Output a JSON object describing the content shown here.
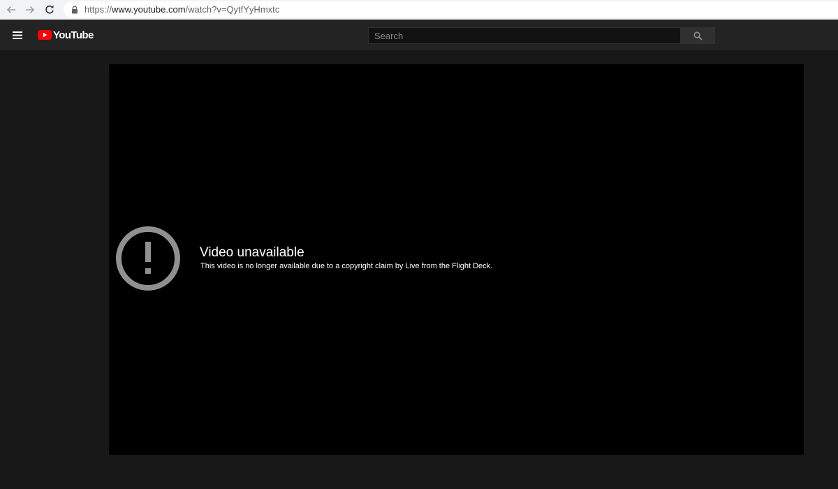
{
  "browser": {
    "url_prefix": "https://",
    "url_host": "www.youtube.com",
    "url_path": "/watch?v=QytfYyHmxtc",
    "icons": {
      "back": "arrow-left-icon",
      "forward": "arrow-right-icon",
      "reload": "reload-icon",
      "secure": "lock-icon"
    }
  },
  "masthead": {
    "logo_text": "YouTube",
    "search_placeholder": "Search",
    "icons": {
      "menu": "hamburger-menu-icon",
      "search": "search-icon",
      "logo": "youtube-play-icon"
    }
  },
  "player": {
    "error_title": "Video unavailable",
    "error_message": "This video is no longer available due to a copyright claim by Live from the Flight Deck.",
    "icon": "alert-circle-icon"
  },
  "colors": {
    "page_bg": "#181818",
    "masthead_bg": "#232323",
    "player_bg": "#000000",
    "brand_red": "#ff0000",
    "icon_gray": "#909090"
  }
}
